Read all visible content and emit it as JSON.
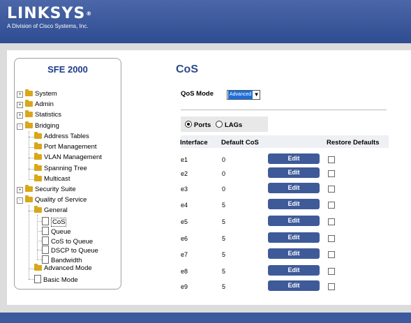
{
  "header": {
    "logo_text": "LINKSYS",
    "logo_reg": "®",
    "logo_subtitle": "A Division of Cisco Systems, Inc.",
    "bg_color": "#3a589c"
  },
  "sidebar": {
    "title": "SFE 2000",
    "items": [
      {
        "label": "System",
        "type": "folder",
        "expander": "+"
      },
      {
        "label": "Admin",
        "type": "folder",
        "expander": "+"
      },
      {
        "label": "Statistics",
        "type": "folder",
        "expander": "+"
      },
      {
        "label": "Bridging",
        "type": "folder",
        "expander": "-"
      },
      {
        "label": "Address Tables",
        "type": "folder"
      },
      {
        "label": "Port Management",
        "type": "folder"
      },
      {
        "label": "VLAN Management",
        "type": "folder"
      },
      {
        "label": "Spanning Tree",
        "type": "folder"
      },
      {
        "label": "Multicast",
        "type": "folder"
      },
      {
        "label": "Security Suite",
        "type": "folder",
        "expander": "+"
      },
      {
        "label": "Quality of Service",
        "type": "folder",
        "expander": "-"
      },
      {
        "label": "General",
        "type": "folder"
      },
      {
        "label": "CoS",
        "type": "page",
        "selected": true
      },
      {
        "label": "Queue",
        "type": "page"
      },
      {
        "label": "CoS to Queue",
        "type": "page"
      },
      {
        "label": "DSCP to Queue",
        "type": "page"
      },
      {
        "label": "Bandwidth",
        "type": "page"
      },
      {
        "label": "Advanced Mode",
        "type": "folder"
      },
      {
        "label": "Basic Mode",
        "type": "page"
      }
    ]
  },
  "main": {
    "title": "CoS",
    "qos_mode_label": "QoS Mode",
    "qos_mode_value": "Advanced",
    "radio_ports": "Ports",
    "radio_lags": "LAGs",
    "selected_radio": "Ports",
    "columns": [
      "Interface",
      "Default CoS",
      "",
      "Restore Defaults"
    ],
    "edit_label": "Edit",
    "rows": [
      {
        "interface": "e1",
        "cos": "0"
      },
      {
        "interface": "e2",
        "cos": "0"
      },
      {
        "interface": "e3",
        "cos": "0"
      },
      {
        "interface": "e4",
        "cos": "5"
      },
      {
        "interface": "e5",
        "cos": "5"
      },
      {
        "interface": "e6",
        "cos": "5"
      },
      {
        "interface": "e7",
        "cos": "5"
      },
      {
        "interface": "e8",
        "cos": "5"
      },
      {
        "interface": "e9",
        "cos": "5"
      }
    ],
    "accent_color": "#3e5a99"
  }
}
